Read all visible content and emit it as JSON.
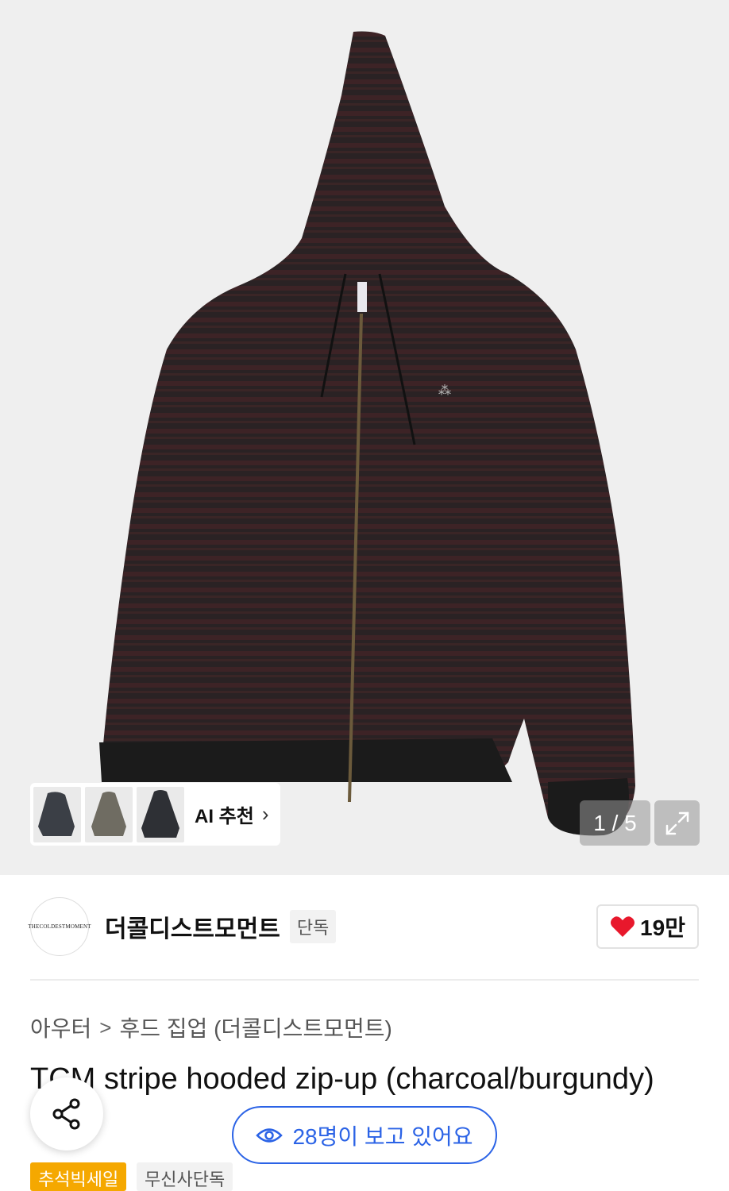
{
  "gallery": {
    "counter": "1 / 5",
    "ai_recommend_label": "AI 추천",
    "chevron": "›",
    "expand_icon": "expand-icon"
  },
  "brand": {
    "logo_text": "THECOLDESTMOMENT",
    "name": "더콜디스트모먼트",
    "badge": "단독",
    "likes": "19만",
    "like_color": "#e8182c"
  },
  "breadcrumb": {
    "items": [
      "아우터",
      "후드 집업 (더콜디스트모먼트)"
    ],
    "separator": ">"
  },
  "product": {
    "title": "TCM stripe hooded zip-up (charcoal/burgundy)"
  },
  "floating": {
    "viewers_text": "28명이 보고 있어요",
    "accent": "#2b63e6"
  },
  "tags": [
    "추석빅세일",
    "무신사단독"
  ],
  "colors": {
    "sale_tag": "#f5a800",
    "hero_bg": "#efefef"
  }
}
